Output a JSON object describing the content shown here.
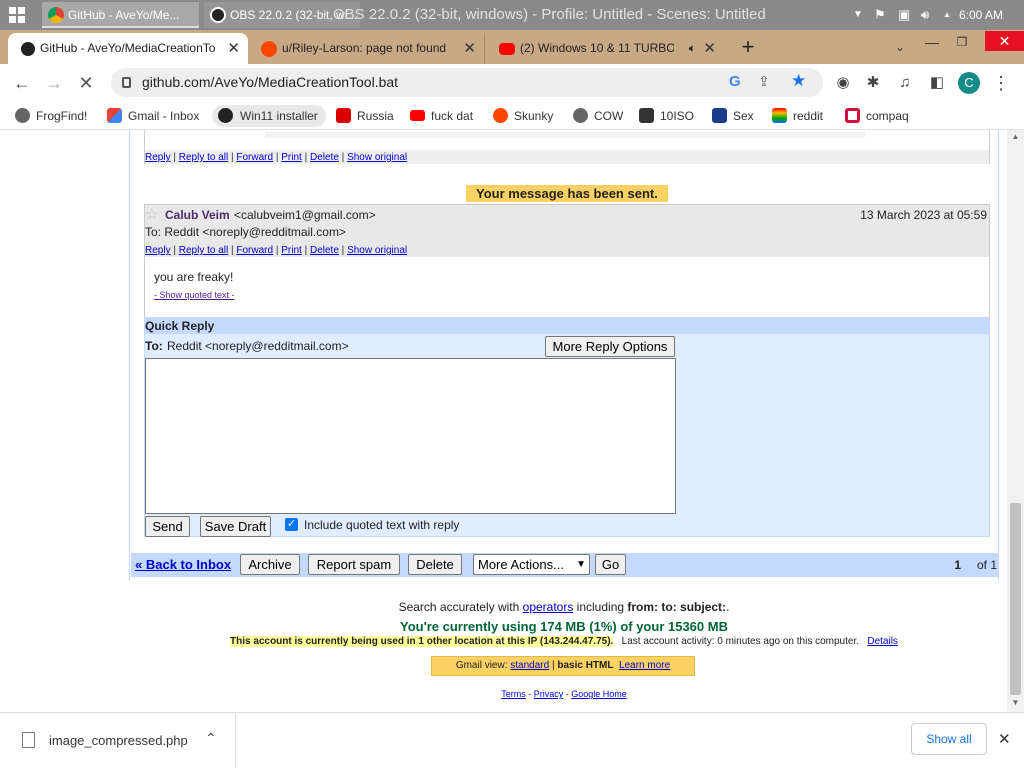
{
  "taskbar": {
    "apps": [
      {
        "label": "GitHub - AveYo/Me..."
      },
      {
        "label": "OBS 22.0.2 (32-bit, wi..."
      }
    ],
    "window_title": "OBS 22.0.2 (32-bit, windows) - Profile: Untitled - Scenes: Untitled",
    "clock": "6:00 AM"
  },
  "tabs": [
    {
      "label": "GitHub - AveYo/MediaCreationTo",
      "icon": "github-icon"
    },
    {
      "label": "u/Riley-Larson: page not found",
      "icon": "reddit-icon"
    },
    {
      "label": "(2) Windows 10 & 11 TURBO",
      "icon": "youtube-icon"
    }
  ],
  "address": {
    "url": "github.com/AveYo/MediaCreationTool.bat",
    "profile_initial": "C"
  },
  "bookmarks": [
    {
      "label": "FrogFind!"
    },
    {
      "label": "Gmail - Inbox"
    },
    {
      "label": "Win11 installer"
    },
    {
      "label": "Russia"
    },
    {
      "label": "fuck dat"
    },
    {
      "label": "Skunky"
    },
    {
      "label": "COW"
    },
    {
      "label": "10ISO"
    },
    {
      "label": "Sex"
    },
    {
      "label": "reddit"
    },
    {
      "label": "compaq"
    }
  ],
  "actions": {
    "reply": "Reply",
    "reply_all": "Reply to all",
    "forward": "Forward",
    "print": "Print",
    "delete": "Delete",
    "show_original": "Show original",
    "sep": "|"
  },
  "sent_notice": "Your message has been sent.",
  "message": {
    "sender_name": "Calub Veim",
    "sender_email": "<calubveim1@gmail.com>",
    "date": "13 March 2023 at 05:59",
    "to": "To: Reddit <noreply@redditmail.com>",
    "body": "you are freaky!",
    "show_quoted": "- Show quoted text -"
  },
  "quick_reply": {
    "title": "Quick Reply",
    "to_label": "To:",
    "to_value": "Reddit <noreply@redditmail.com>",
    "more_options": "More Reply Options",
    "send": "Send",
    "save_draft": "Save Draft",
    "include_quoted": "Include quoted text with reply",
    "include_checked": true
  },
  "navbar": {
    "back": "« Back to Inbox",
    "archive": "Archive",
    "report_spam": "Report spam",
    "delete": "Delete",
    "more_actions": "More Actions...",
    "go": "Go",
    "page_num": "1",
    "page_of": "of 1"
  },
  "footer": {
    "search_pre": "Search accurately with ",
    "operators": "operators",
    "search_mid": " including ",
    "search_ops": "from:  to:  subject:",
    "search_end": ".",
    "usage": "You're currently using 174 MB (1%) of your 15360 MB",
    "account_warning": "This account is currently being used in 1 other location at this IP (143.244.47.75).",
    "last_activity": "Last account activity: 0 minutes ago on this computer.",
    "details": "Details",
    "view_pre": "Gmail view: ",
    "standard": "standard",
    "view_sep": " | ",
    "basic": "basic HTML",
    "learn_more": "Learn more",
    "terms": "Terms",
    "privacy": "Privacy",
    "google_home": "Google Home",
    "dash": " - "
  },
  "download": {
    "filename": "image_compressed.php",
    "show_all": "Show all"
  },
  "colors": {
    "accent_blue": "#c3d9ff",
    "quick_reply_bg": "#e0ecff",
    "notice_yellow": "#fad163",
    "usage_green": "#006633"
  }
}
